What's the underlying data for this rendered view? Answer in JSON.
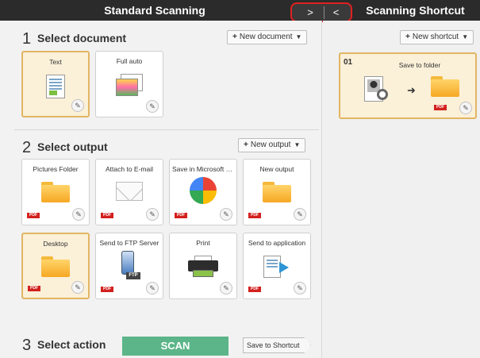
{
  "titlebar": {
    "main_title": "Standard Scanning",
    "side_title": "Scanning Shortcut",
    "next_label": ">",
    "prev_label": "<"
  },
  "select_document": {
    "number": "1",
    "title": "Select document",
    "new_button": "New document",
    "cards": [
      {
        "label": "Text",
        "icon": "text-document-icon",
        "selected": true
      },
      {
        "label": "Full auto",
        "icon": "photo-document-icon",
        "selected": false
      }
    ]
  },
  "select_output": {
    "number": "2",
    "title": "Select output",
    "new_button": "New output",
    "pdf_badge": "PDF",
    "cards": [
      {
        "label": "Pictures Folder",
        "icon": "folder-icon",
        "selected": false
      },
      {
        "label": "Attach to E-mail",
        "icon": "mail-icon",
        "selected": false
      },
      {
        "label": "Save in Microsoft S...",
        "icon": "onenote-icon",
        "selected": false
      },
      {
        "label": "New output",
        "icon": "folder-icon",
        "selected": false
      },
      {
        "label": "Desktop",
        "icon": "folder-icon",
        "selected": true
      },
      {
        "label": "Send to FTP Server",
        "icon": "ftp-icon",
        "selected": false
      },
      {
        "label": "Print",
        "icon": "printer-icon",
        "selected": false
      },
      {
        "label": "Send to application",
        "icon": "app-icon",
        "selected": false
      }
    ],
    "ftp_tag": "FTP"
  },
  "select_action": {
    "number": "3",
    "title": "Select action",
    "scan_button": "SCAN",
    "shortcut_button": "Save to Shortcut"
  },
  "shortcuts": {
    "new_button": "New shortcut",
    "items": [
      {
        "number": "01",
        "label": "Save to folder",
        "badge": "PDF"
      }
    ]
  },
  "colors": {
    "selected_bg": "#fbf0d8",
    "selected_border": "#e2b563",
    "scan_green": "#5bb588",
    "titlebar": "#2b2b2b",
    "highlight_red": "#e02020"
  }
}
